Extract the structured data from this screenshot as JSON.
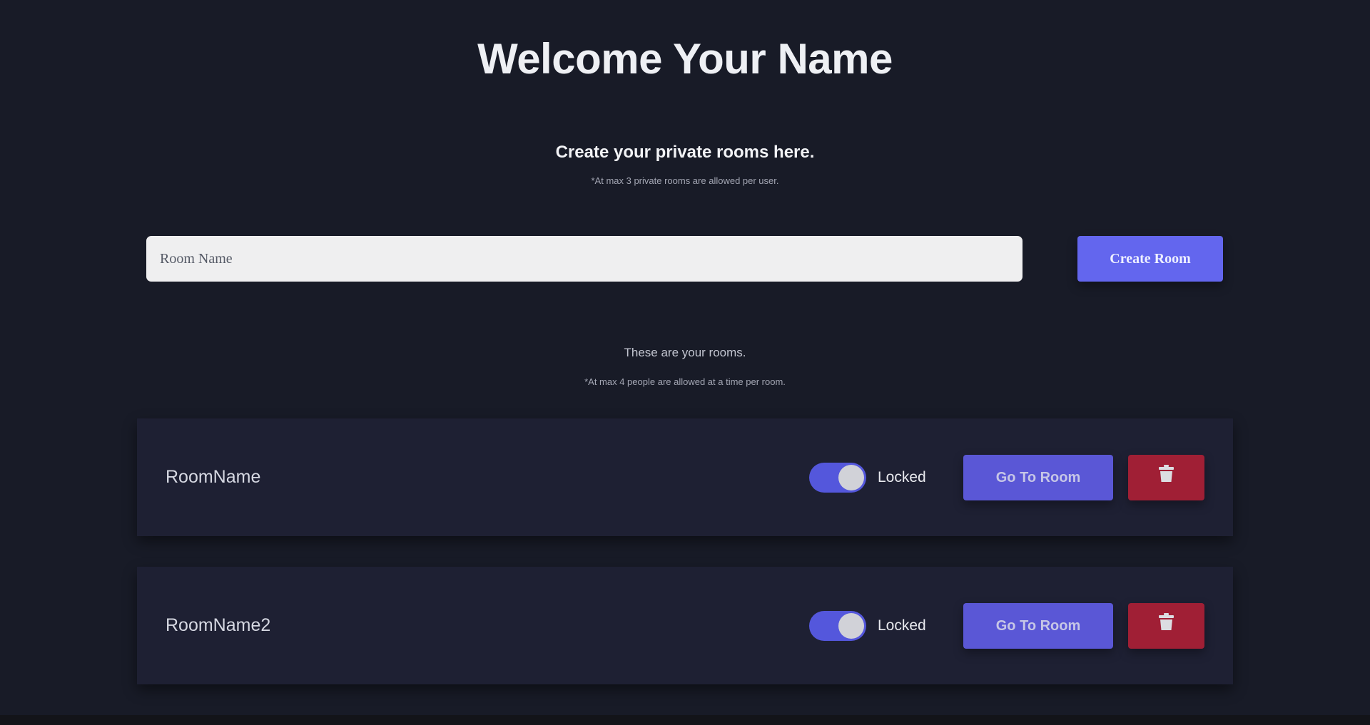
{
  "header": {
    "title": "Welcome Your Name"
  },
  "create_section": {
    "heading": "Create your private rooms here.",
    "note": "*At max 3 private rooms are allowed per user.",
    "input_placeholder": "Room Name",
    "input_value": "",
    "button_label": "Create Room"
  },
  "rooms_section": {
    "heading": "These are your rooms.",
    "note": "*At max 4 people are allowed at a time per room.",
    "rooms": [
      {
        "name": "RoomName",
        "locked": true,
        "lock_label": "Locked",
        "go_label": "Go To Room",
        "delete_icon": "trash-icon"
      },
      {
        "name": "RoomName2",
        "locked": true,
        "lock_label": "Locked",
        "go_label": "Go To Room",
        "delete_icon": "trash-icon"
      }
    ]
  },
  "colors": {
    "background": "#181b27",
    "card": "#1e2033",
    "accent": "#6366ee",
    "toggle_on": "#5457dc",
    "danger": "#a01f35"
  }
}
